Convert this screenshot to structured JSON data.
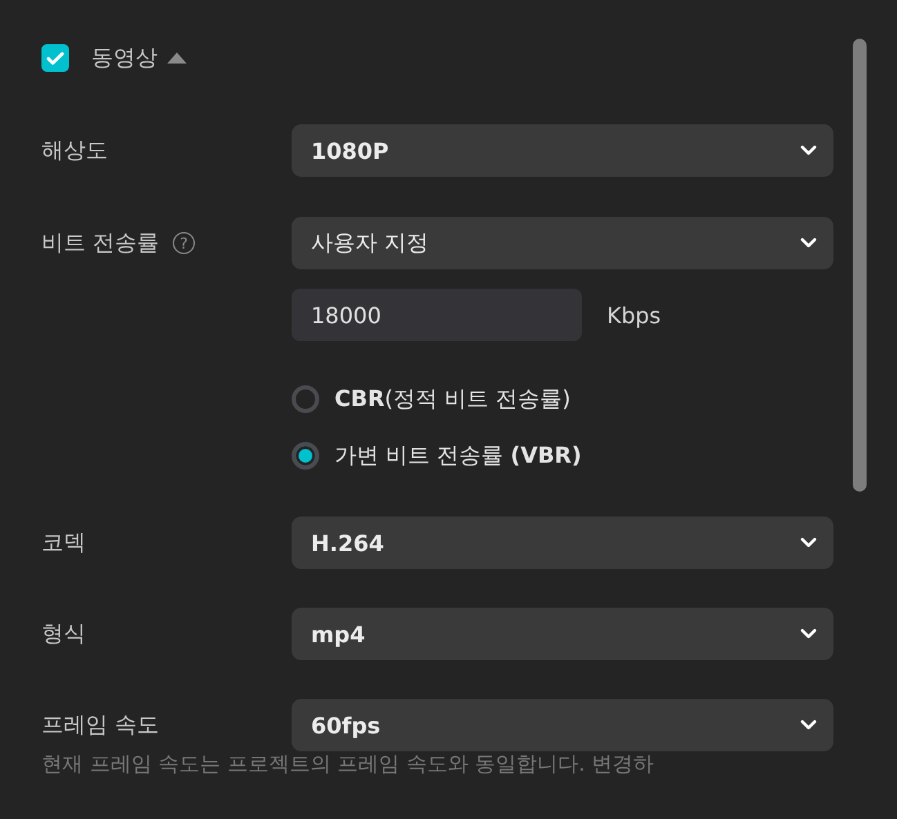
{
  "section": {
    "title": "동영상",
    "checked": true,
    "expanded": true
  },
  "settings": [
    {
      "kind": "select",
      "label": "해상도",
      "value": "1080P"
    },
    {
      "kind": "bitrate",
      "label": "비트 전송률",
      "help": "?",
      "value": "사용자 지정",
      "input": "18000",
      "unit": "Kbps",
      "options": [
        {
          "label": "**CBR**(정적 비트 전송률)",
          "selected": false
        },
        {
          "label": "가변 비트 전송률 **(VBR)**",
          "selected": true
        }
      ]
    },
    {
      "kind": "select",
      "label": "코덱",
      "value": "H.264"
    },
    {
      "kind": "select",
      "label": "형식",
      "value": "mp4"
    },
    {
      "kind": "select",
      "label": "프레임 속도",
      "value": "60fps",
      "note": "현재 프레임 속도는 프로젝트의 프레임 속도와 동일합니다. 변경하"
    }
  ]
}
